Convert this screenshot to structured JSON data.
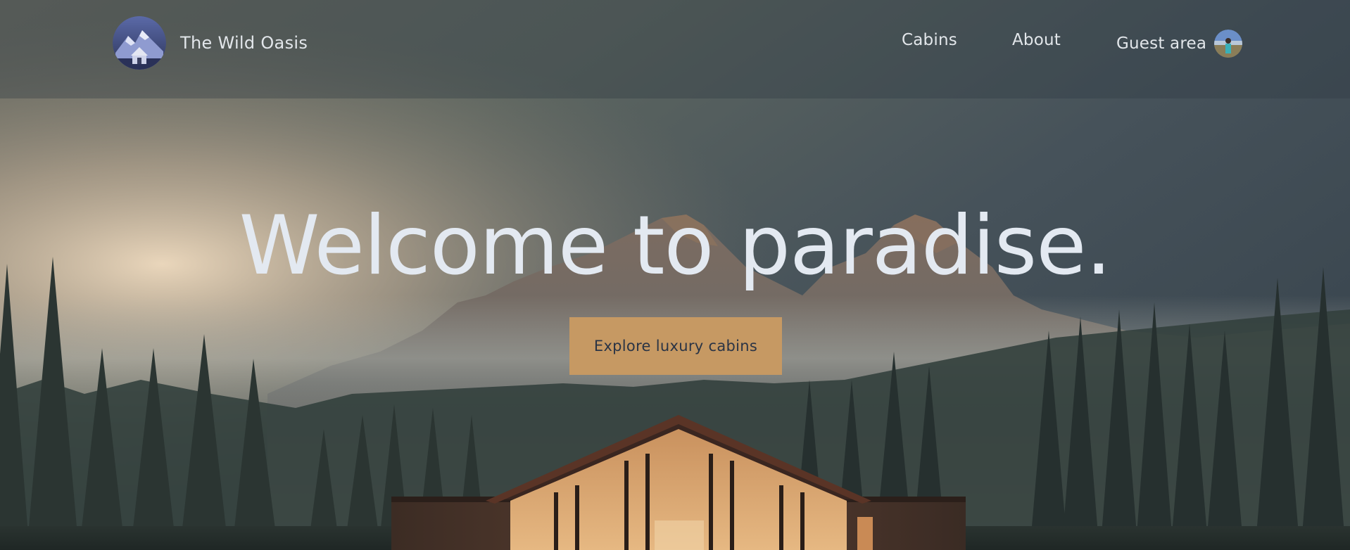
{
  "header": {
    "logo_text": "The Wild Oasis",
    "nav": {
      "cabins": "Cabins",
      "about": "About",
      "guest_area": "Guest area"
    }
  },
  "hero": {
    "headline": "Welcome to paradise.",
    "cta_label": "Explore luxury cabins"
  },
  "colors": {
    "accent": "#c69963",
    "text_light": "#e3e9f1",
    "text_dark": "#2a3445"
  },
  "icons": {
    "logo": "mountain-cabin-logo",
    "avatar": "user-avatar"
  }
}
